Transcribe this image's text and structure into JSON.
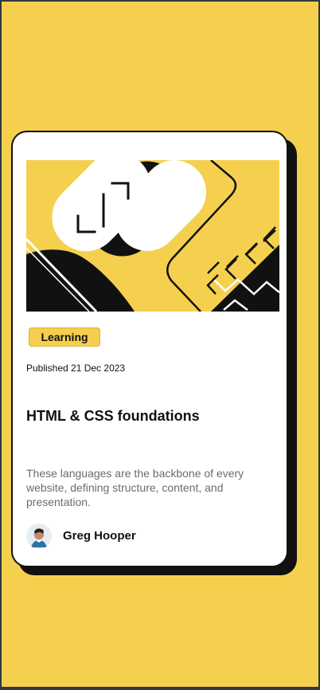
{
  "card": {
    "category": "Learning",
    "published": "Published 21 Dec 2023",
    "title": "HTML & CSS foundations",
    "description": "These languages are the backbone of every website, defining structure, content, and presentation.",
    "author": {
      "name": "Greg Hooper"
    }
  },
  "colors": {
    "background": "#f4d04e",
    "card": "#ffffff",
    "text": "#111111",
    "muted": "#6b6b6b"
  },
  "icons": {
    "hero": "hero-illustration",
    "avatar": "author-avatar"
  }
}
